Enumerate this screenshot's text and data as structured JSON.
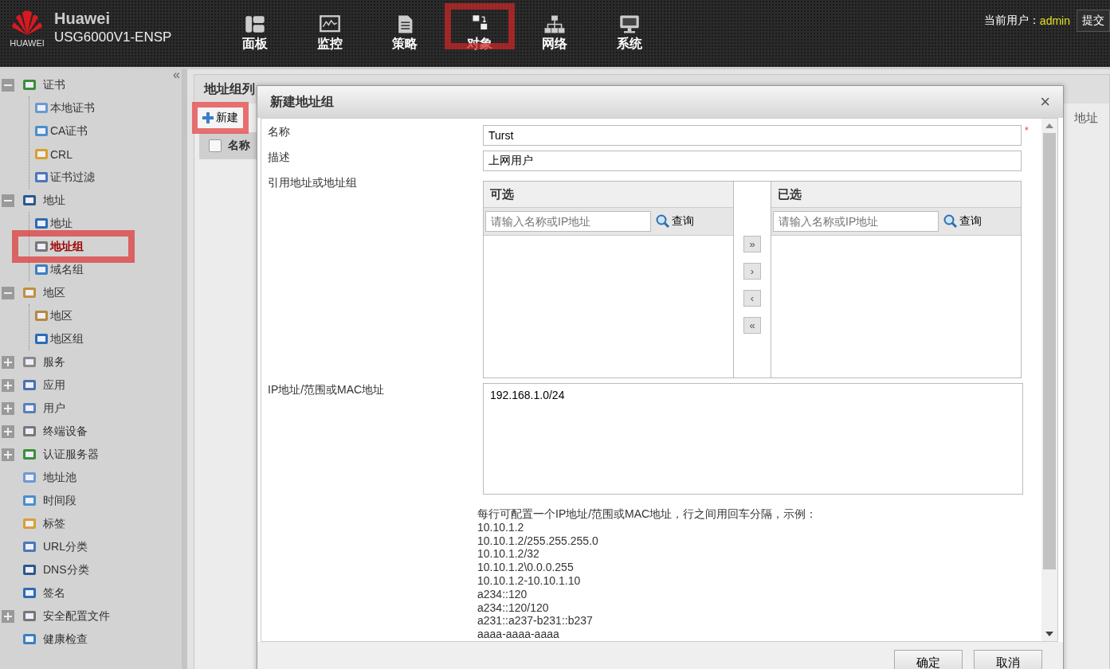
{
  "header": {
    "brand": "Huawei",
    "logo_text": "HUAWEI",
    "model": "USG6000V1-ENSP",
    "nav": [
      {
        "label": "面板",
        "marked": false
      },
      {
        "label": "监控",
        "marked": false
      },
      {
        "label": "策略",
        "marked": false
      },
      {
        "label": "对象",
        "marked": true
      },
      {
        "label": "网络",
        "marked": false
      },
      {
        "label": "系统",
        "marked": false
      }
    ],
    "user_label": "当前用户：",
    "user": "admin",
    "submit": "提交"
  },
  "sidebar": {
    "collapse": "«",
    "items": [
      {
        "label": "证书",
        "expanded": true,
        "selected": false,
        "marked": false,
        "children": [
          {
            "label": "本地证书",
            "selected": false,
            "marked": false
          },
          {
            "label": "CA证书",
            "selected": false,
            "marked": false
          },
          {
            "label": "CRL",
            "selected": false,
            "marked": false
          },
          {
            "label": "证书过滤",
            "selected": false,
            "marked": false
          }
        ]
      },
      {
        "label": "地址",
        "expanded": true,
        "selected": false,
        "marked": false,
        "children": [
          {
            "label": "地址",
            "selected": false,
            "marked": false
          },
          {
            "label": "地址组",
            "selected": true,
            "marked": true
          },
          {
            "label": "域名组",
            "selected": false,
            "marked": false
          }
        ]
      },
      {
        "label": "地区",
        "expanded": true,
        "selected": false,
        "marked": false,
        "children": [
          {
            "label": "地区",
            "selected": false,
            "marked": false
          },
          {
            "label": "地区组",
            "selected": false,
            "marked": false
          }
        ]
      },
      {
        "label": "服务",
        "expanded": false,
        "selected": false,
        "marked": false
      },
      {
        "label": "应用",
        "expanded": false,
        "selected": false,
        "marked": false
      },
      {
        "label": "用户",
        "expanded": false,
        "selected": false,
        "marked": false
      },
      {
        "label": "终端设备",
        "expanded": false,
        "selected": false,
        "marked": false
      },
      {
        "label": "认证服务器",
        "expanded": false,
        "selected": false,
        "marked": false
      },
      {
        "label": "地址池",
        "selected": false,
        "marked": false
      },
      {
        "label": "时间段",
        "selected": false,
        "marked": false
      },
      {
        "label": "标签",
        "selected": false,
        "marked": false
      },
      {
        "label": "URL分类",
        "selected": false,
        "marked": false
      },
      {
        "label": "DNS分类",
        "selected": false,
        "marked": false
      },
      {
        "label": "签名",
        "selected": false,
        "marked": false
      },
      {
        "label": "安全配置文件",
        "expanded": false,
        "selected": false,
        "marked": false
      },
      {
        "label": "健康检查",
        "selected": false,
        "marked": false
      }
    ]
  },
  "panel": {
    "title": "地址组列",
    "new_button": {
      "label": "新建",
      "marked": true
    },
    "column_1": "名称",
    "checked": false,
    "column_right": "地址"
  },
  "dialog": {
    "title": "新建地址组",
    "close": "×",
    "name_label": "名称",
    "name_value": "Turst",
    "required": "*",
    "desc_label": "描述",
    "desc_value": "上网用户",
    "ref_label": "引用地址或地址组",
    "available": {
      "title": "可选",
      "placeholder": "请输入名称或IP地址",
      "search": "查询"
    },
    "chosen": {
      "title": "已选",
      "placeholder": "请输入名称或IP地址",
      "search": "查询"
    },
    "move_buttons": [
      "»",
      "›",
      "‹",
      "«"
    ],
    "ip_label": "IP地址/范围或MAC地址",
    "ip_value": "192.168.1.0/24",
    "hint": "每行可配置一个IP地址/范围或MAC地址，行之间用回车分隔，示例：",
    "examples": [
      "10.10.1.2",
      "10.10.1.2/255.255.255.0",
      "10.10.1.2/32",
      "10.10.1.2\\0.0.0.255",
      "10.10.1.2-10.10.1.10",
      "a234::120",
      "a234::120/120",
      "a231::a237-b231::b237",
      "aaaa-aaaa-aaaa"
    ],
    "buttons": [
      "确定",
      "取消"
    ]
  }
}
